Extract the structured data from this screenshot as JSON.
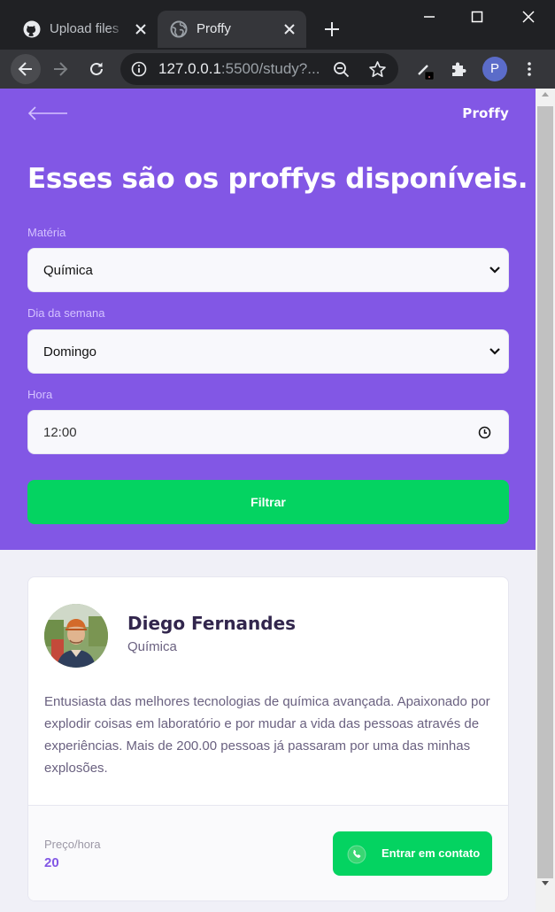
{
  "browser": {
    "tabs": [
      {
        "title": "Upload files · ",
        "icon": "github-icon",
        "active": false
      },
      {
        "title": "Proffy",
        "icon": "globe-icon",
        "active": true
      }
    ],
    "address": {
      "host": "127.0.0.1",
      "rest": ":5500/study?..."
    },
    "profile_initial": "P"
  },
  "page": {
    "logo": "Proffy",
    "headline": "Esses são os proffys disponíveis.",
    "filters": {
      "subject_label": "Matéria",
      "subject_value": "Química",
      "weekday_label": "Dia da semana",
      "weekday_value": "Domingo",
      "time_label": "Hora",
      "time_value": "12:00",
      "submit_label": "Filtrar"
    },
    "teacher": {
      "name": "Diego Fernandes",
      "subject": "Química",
      "bio": "Entusiasta das melhores tecnologias de química avançada. Apaixonado por explodir coisas em laboratório e por mudar a vida das pessoas através de experiências. Mais de 200.00 pessoas já passaram por uma das minhas explosões.",
      "price_label": "Preço/hora",
      "price_value": "20",
      "contact_label": "Entrar em contato"
    }
  },
  "colors": {
    "primary": "#8257e5",
    "secondary": "#04d361",
    "background": "#f0f0f7",
    "title": "#32264d",
    "text": "#6a6180"
  }
}
